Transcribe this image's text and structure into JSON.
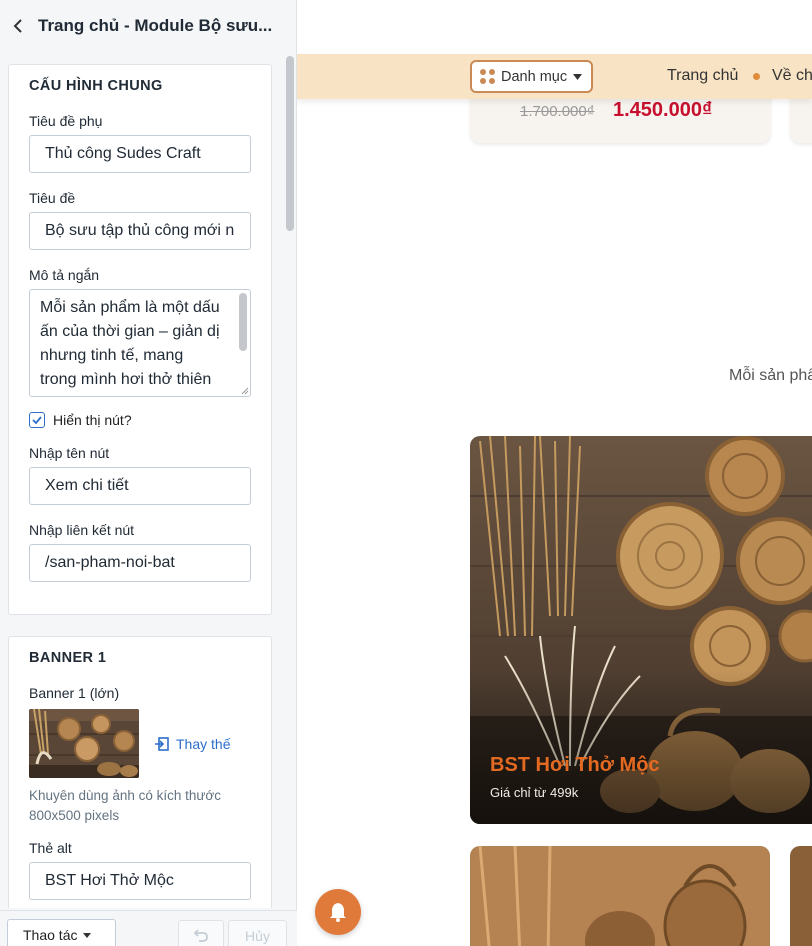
{
  "header": {
    "title": "Trang chủ - Module Bộ sưu..."
  },
  "general": {
    "section_title": "CẤU HÌNH CHUNG",
    "subtitle_label": "Tiêu đề phụ",
    "subtitle_value": "Thủ công Sudes Craft",
    "title_label": "Tiêu đề",
    "title_value": "Bộ sưu tập thủ công mới n",
    "desc_label": "Mô tả ngắn",
    "desc_lines": [
      "Mỗi sản phẩm là một dấu",
      "ấn của thời gian – giản dị",
      "nhưng tinh tế, mang",
      "trong mình hơi thở thiên"
    ],
    "show_button_label": "Hiển thị nút?",
    "show_button_checked": true,
    "button_name_label": "Nhập tên nút",
    "button_name_value": "Xem chi tiết",
    "button_link_label": "Nhập liên kết nút",
    "button_link_value": "/san-pham-noi-bat"
  },
  "banner1": {
    "section_title": "BANNER 1",
    "image_label": "Banner 1 (lớn)",
    "replace_label": "Thay thế",
    "hint": "Khuyên dùng ảnh có kích thước 800x500 pixels",
    "alt_label": "Thẻ alt",
    "alt_value": "BST Hơi Thở Mộc"
  },
  "footer": {
    "actions_label": "Thao tác",
    "cancel_label": "Hủy"
  },
  "preview": {
    "category_label": "Danh mục",
    "nav_home": "Trang chủ",
    "nav_about": "Về ch",
    "old_price": "1.700.000₫",
    "new_price": "1.450.000₫",
    "desc_partial": "Mỗi sản phẩ",
    "banner_title": "BST Hơi Thở Mộc",
    "banner_sub": "Giá chỉ từ 499k"
  },
  "colors": {
    "accent": "#2c6ecb",
    "nav_bg": "#f8e4c5",
    "brand_orange": "#e07a3b",
    "price_red": "#c8102e"
  }
}
